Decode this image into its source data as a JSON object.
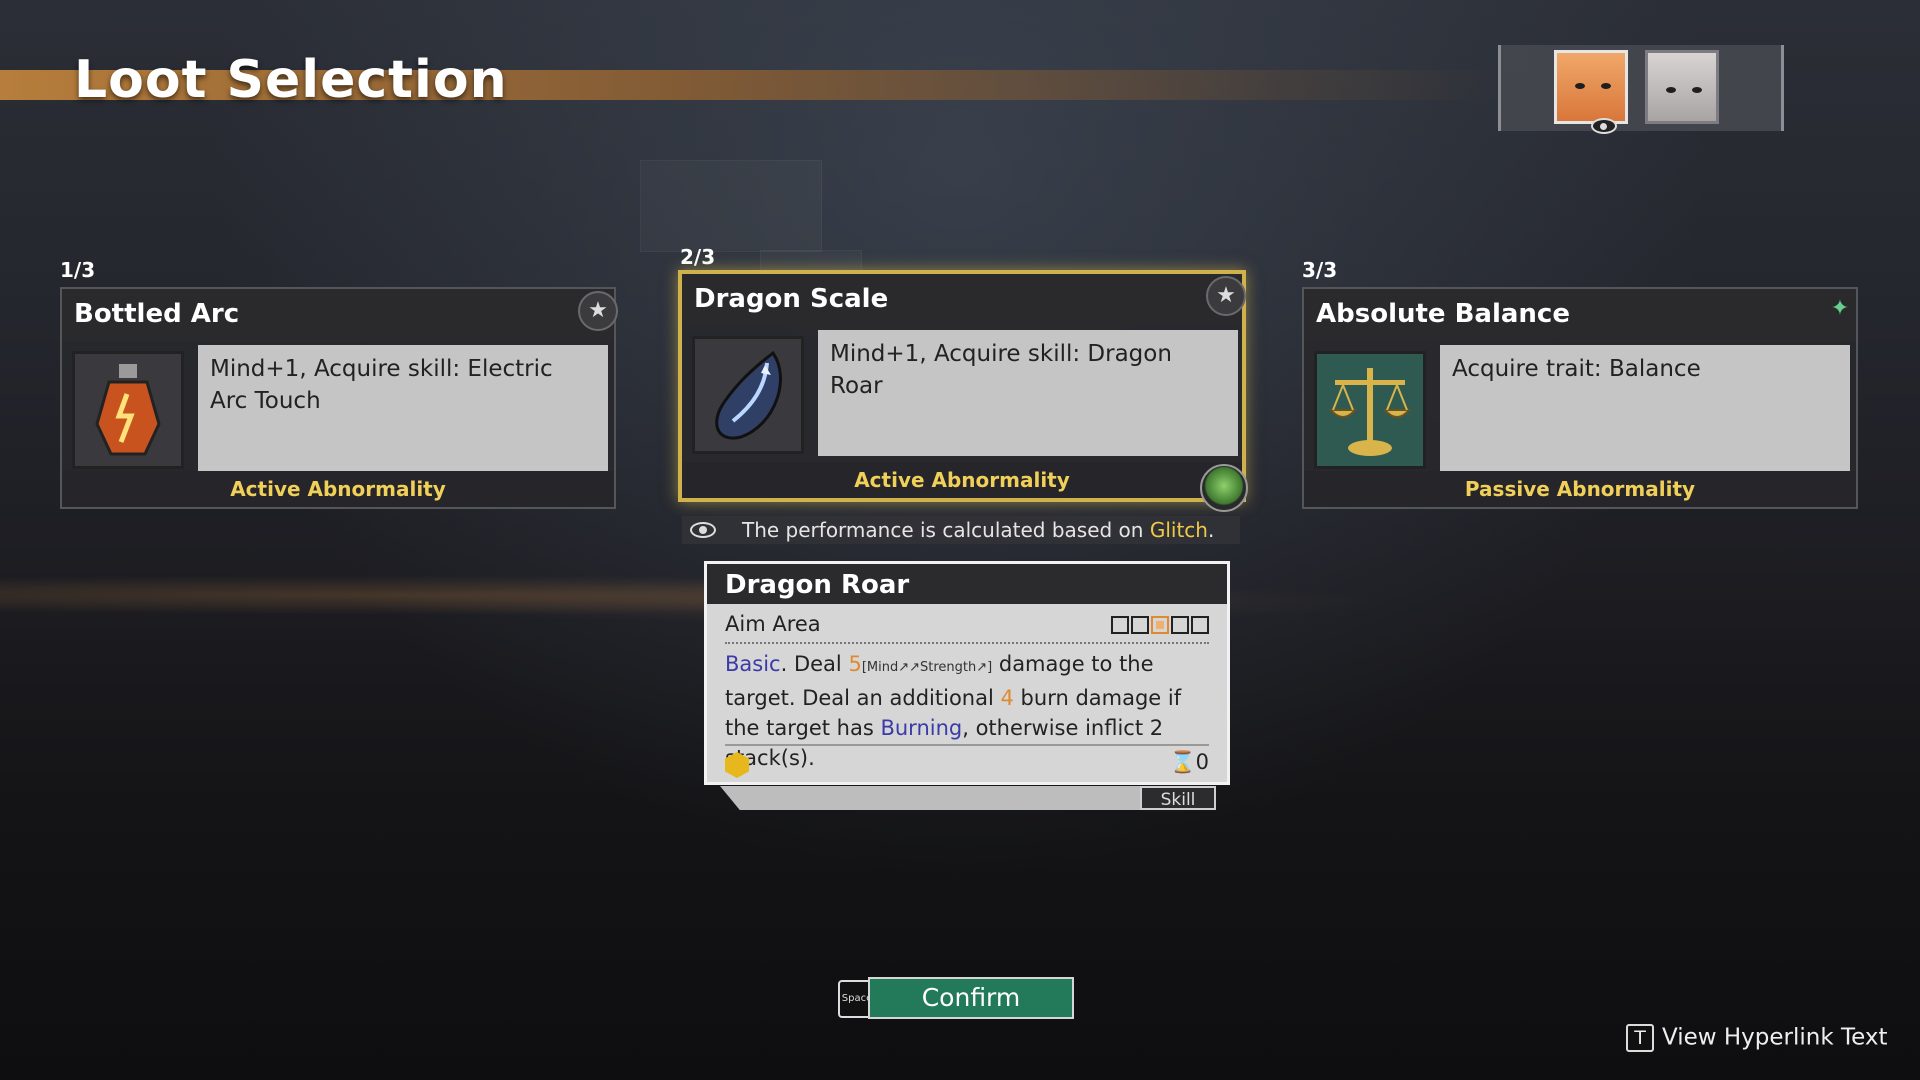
{
  "header": {
    "title": "Loot Selection"
  },
  "party": [
    {
      "name": "Glitch",
      "selected": true
    },
    {
      "name": "",
      "selected": false
    }
  ],
  "cards": [
    {
      "slot": "1/3",
      "name": "Bottled Arc",
      "description": "Mind+1, Acquire skill: Electric Arc Touch",
      "type": "Active Abnormality",
      "icon": "lightning-bottle-icon",
      "star": "star-icon"
    },
    {
      "slot": "2/3",
      "name": "Dragon Scale",
      "description": "Mind+1, Acquire skill: Dragon Roar",
      "type": "Active Abnormality",
      "icon": "dragon-scale-icon",
      "star": "star-icon"
    },
    {
      "slot": "3/3",
      "name": "Absolute Balance",
      "description": "Acquire trait: Balance",
      "type": "Passive Abnormality",
      "icon": "scales-icon",
      "star": "sparkle-icon"
    }
  ],
  "performance_note": {
    "prefix": "The performance is calculated based on ",
    "character": "Glitch",
    "suffix": "."
  },
  "skill_tooltip": {
    "title": "Dragon Roar",
    "aim_label": "Aim Area",
    "aim_cells": [
      false,
      false,
      true,
      false,
      false
    ],
    "desc": {
      "basic": "Basic",
      "t1": ". Deal ",
      "dmg1": "5",
      "scaling": "[Mind↗↗Strength↗]",
      "t2": " damage to the target. Deal an additional ",
      "dmg2": "4",
      "t3": " burn damage if the target has ",
      "status": "Burning",
      "t4": ", otherwise inflict 2 stack(s)."
    },
    "cooldown": "0",
    "tab_label": "Skill"
  },
  "confirm": {
    "key": "Space",
    "label": "Confirm"
  },
  "hyperlink": {
    "key": "T",
    "label": "View Hyperlink Text"
  },
  "colors": {
    "accent_gold": "#f1d05a",
    "confirm_green": "#237a5a",
    "keyword_blue": "#3a3aa8",
    "number_orange": "#e08a2f"
  }
}
